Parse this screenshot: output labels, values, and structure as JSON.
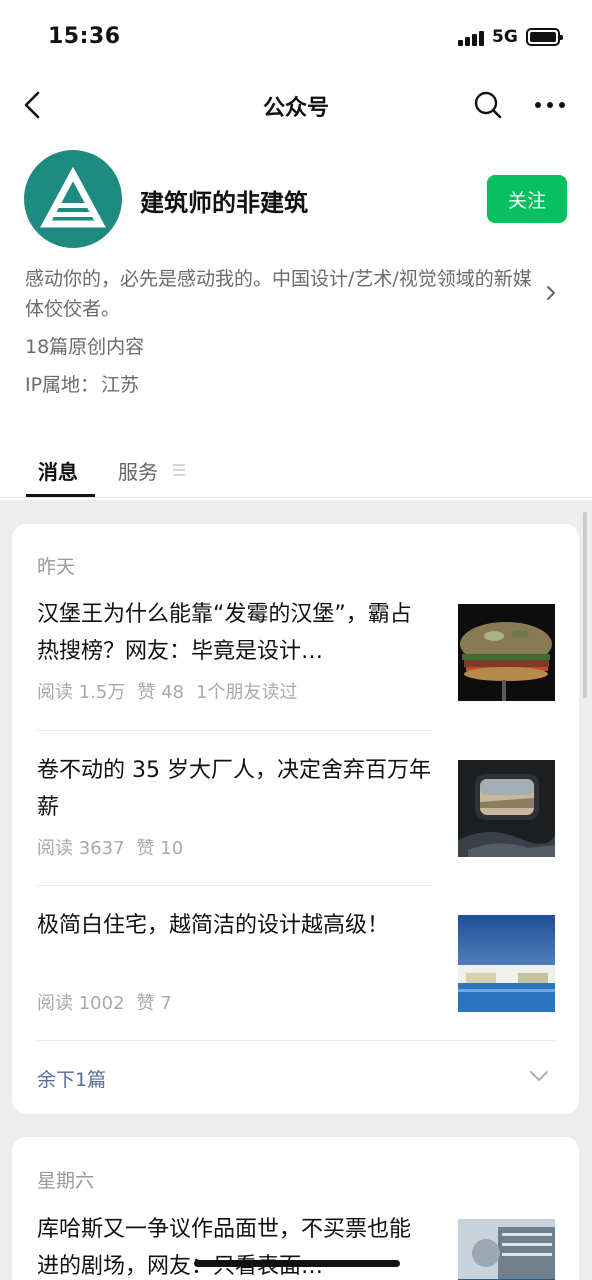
{
  "status_bar": {
    "time": "15:36",
    "network": "5G"
  },
  "nav": {
    "title": "公众号"
  },
  "profile": {
    "name": "建筑师的非建筑",
    "follow_label": "关注",
    "description": "感动你的，必先是感动我的。中国设计/艺术/视觉领域的新媒体佼佼者。",
    "original_count": "18篇原创内容",
    "ip_label": "IP属地：",
    "ip_value": "江苏"
  },
  "tabs": [
    {
      "label": "消息",
      "active": true
    },
    {
      "label": "服务",
      "active": false
    }
  ],
  "groups": [
    {
      "day": "昨天",
      "articles": [
        {
          "title": "汉堡王为什么能靠“发霉的汉堡”，霸占热搜榜？网友：毕竟是设计…",
          "reads": "阅读 1.5万",
          "likes": "赞 48",
          "friends": "1个朋友读过"
        },
        {
          "title": "卷不动的 35 岁大厂人，决定舍弃百万年薪",
          "reads": "阅读 3637",
          "likes": "赞 10"
        },
        {
          "title": "极简白住宅，越简洁的设计越高级！",
          "reads": "阅读 1002",
          "likes": "赞 7"
        }
      ],
      "remaining": "余下1篇"
    },
    {
      "day": "星期六",
      "articles": [
        {
          "title": "库哈斯又一争议作品面世，不买票也能进的剧场，网友：只看表面…"
        }
      ]
    }
  ],
  "colors": {
    "accent_green": "#07c160",
    "link_blue": "#576b95",
    "avatar_teal": "#1d8b7f"
  },
  "icons": [
    "back-chevron-icon",
    "search-icon",
    "more-icon",
    "chevron-right-icon",
    "menu-lines-icon",
    "chevron-down-icon"
  ]
}
